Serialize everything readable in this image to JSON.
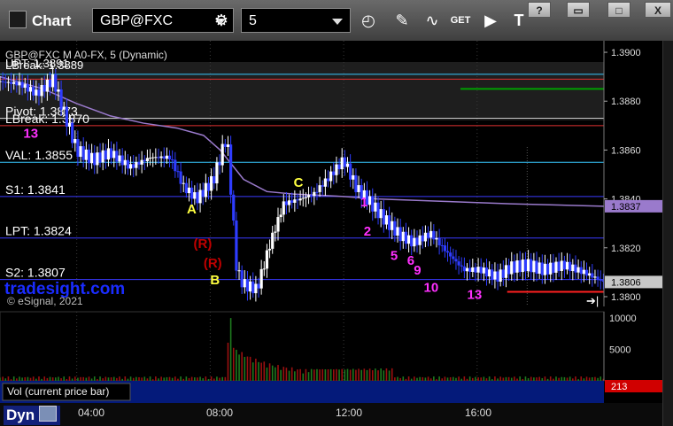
{
  "window": {
    "title": "Chart",
    "symbol": "GBP@FXC",
    "interval": "5",
    "icons": [
      "gear-icon",
      "clock-icon",
      "pencil-icon",
      "indicator-icon",
      "get-icon",
      "play-icon",
      "text-tool-icon"
    ],
    "window_buttons": [
      "?",
      "▭",
      "□",
      "X"
    ]
  },
  "chart_data": {
    "type": "candlestick",
    "header": "GBP@FXC M A0-FX, 5 (Dynamic)",
    "overlapping_labels": [
      "UPT: 1.3891",
      "LBreak: 1.3889"
    ],
    "watermark": "tradesight.com",
    "copyright": "© eSignal, 2021",
    "price_axis": {
      "ylim": [
        1.3796,
        1.3904
      ],
      "ticks": [
        "1.3800",
        "1.3820",
        "1.3840",
        "1.3860",
        "1.3880",
        "1.3900"
      ]
    },
    "time_axis": {
      "ticks": [
        "04:00",
        "08:00",
        "12:00",
        "16:00"
      ],
      "xlim_hours": [
        1.7,
        19.8
      ]
    },
    "current_price": "1.3806",
    "vwap_price_label": "1.3837",
    "levels": [
      {
        "label": "UPT: 1.3891",
        "price": 1.3891,
        "color": "#38c8ff",
        "show_label": false
      },
      {
        "label": "LBreak: 1.3889",
        "price": 1.3889,
        "color": "#e03030",
        "show_label": false
      },
      {
        "label": "Pivot: 1.3873",
        "price": 1.3873,
        "color": "#c8c8c8",
        "show_label": true
      },
      {
        "label": "LBreak: 1.3870",
        "price": 1.387,
        "color": "#e03030",
        "show_label": true
      },
      {
        "label": "VAL: 1.3855",
        "price": 1.3855,
        "color": "#38c8ff",
        "show_label": true
      },
      {
        "label": "S1: 1.3841",
        "price": 1.3841,
        "color": "#3a3aff",
        "show_label": true
      },
      {
        "label": "LPT: 1.3824",
        "price": 1.3824,
        "color": "#3a3aff",
        "show_label": true
      },
      {
        "label": "S2: 1.3807",
        "price": 1.3807,
        "color": "#3a3aff",
        "show_label": true
      }
    ],
    "target_marks": [
      {
        "price": 1.3885,
        "t0": 15.5,
        "t1": 19.8,
        "color": "#00a000"
      },
      {
        "price": 1.3802,
        "t0": 16.9,
        "t1": 19.8,
        "color": "#ff2020"
      }
    ],
    "annotations": [
      {
        "text": "A",
        "t": 7.3,
        "price": 1.3834,
        "color": "#ffff40"
      },
      {
        "text": "B",
        "t": 8.0,
        "price": 1.3805,
        "color": "#ffff40"
      },
      {
        "text": "C",
        "t": 10.5,
        "price": 1.3845,
        "color": "#ffff40"
      },
      {
        "text": "(R)",
        "t": 7.5,
        "price": 1.382,
        "color": "#c00000"
      },
      {
        "text": "(R)",
        "t": 7.8,
        "price": 1.3812,
        "color": "#c00000"
      },
      {
        "text": "13",
        "t": 2.4,
        "price": 1.3865,
        "color": "#ff30ff"
      },
      {
        "text": "1",
        "t": 12.5,
        "price": 1.3837,
        "color": "#ff30ff"
      },
      {
        "text": "2",
        "t": 12.6,
        "price": 1.3825,
        "color": "#ff30ff"
      },
      {
        "text": "5",
        "t": 13.4,
        "price": 1.3815,
        "color": "#ff30ff"
      },
      {
        "text": "6",
        "t": 13.9,
        "price": 1.3813,
        "color": "#ff30ff"
      },
      {
        "text": "9",
        "t": 14.1,
        "price": 1.3809,
        "color": "#ff30ff"
      },
      {
        "text": "10",
        "t": 14.4,
        "price": 1.3802,
        "color": "#ff30ff"
      },
      {
        "text": "13",
        "t": 15.7,
        "price": 1.3799,
        "color": "#ff30ff"
      }
    ],
    "vwap": [
      [
        1.7,
        1.389
      ],
      [
        3,
        1.3885
      ],
      [
        4,
        1.3879
      ],
      [
        5,
        1.3874
      ],
      [
        6,
        1.3871
      ],
      [
        7,
        1.3869
      ],
      [
        7.8,
        1.3866
      ],
      [
        8.3,
        1.386
      ],
      [
        9,
        1.3848
      ],
      [
        9.7,
        1.3843
      ],
      [
        10.5,
        1.3842
      ],
      [
        12,
        1.3841
      ],
      [
        13,
        1.384
      ],
      [
        15,
        1.3839
      ],
      [
        17,
        1.3838
      ],
      [
        19.8,
        1.3837
      ]
    ],
    "price_path": [
      [
        1.7,
        1.3888
      ],
      [
        2.3,
        1.3887
      ],
      [
        2.8,
        1.3883
      ],
      [
        3.3,
        1.3889
      ],
      [
        3.6,
        1.3876
      ],
      [
        4.0,
        1.386
      ],
      [
        4.5,
        1.3856
      ],
      [
        5.0,
        1.3859
      ],
      [
        5.6,
        1.3853
      ],
      [
        6.2,
        1.3857
      ],
      [
        6.8,
        1.3857
      ],
      [
        7.2,
        1.3845
      ],
      [
        7.6,
        1.384
      ],
      [
        8.1,
        1.3848
      ],
      [
        8.5,
        1.3866
      ],
      [
        8.8,
        1.381
      ],
      [
        9.0,
        1.3805
      ],
      [
        9.4,
        1.3803
      ],
      [
        9.8,
        1.3822
      ],
      [
        10.2,
        1.3838
      ],
      [
        10.7,
        1.384
      ],
      [
        11.1,
        1.3842
      ],
      [
        11.5,
        1.3848
      ],
      [
        12.0,
        1.3856
      ],
      [
        12.4,
        1.3844
      ],
      [
        12.7,
        1.384
      ],
      [
        13.2,
        1.3832
      ],
      [
        13.7,
        1.3825
      ],
      [
        14.1,
        1.3822
      ],
      [
        14.6,
        1.3826
      ],
      [
        15.1,
        1.3818
      ],
      [
        15.6,
        1.3811
      ],
      [
        16.1,
        1.3811
      ],
      [
        16.6,
        1.3808
      ],
      [
        17.0,
        1.3812
      ],
      [
        17.5,
        1.3813
      ],
      [
        18.0,
        1.3811
      ],
      [
        18.6,
        1.3813
      ],
      [
        19.2,
        1.381
      ],
      [
        19.8,
        1.3806
      ]
    ],
    "volume": {
      "label": "Vol (current price bar)",
      "current": "213",
      "ticks": [
        "5000",
        "10000"
      ],
      "ylim": [
        0,
        11000
      ],
      "spike": {
        "t": 8.6,
        "value": 10000
      }
    }
  }
}
